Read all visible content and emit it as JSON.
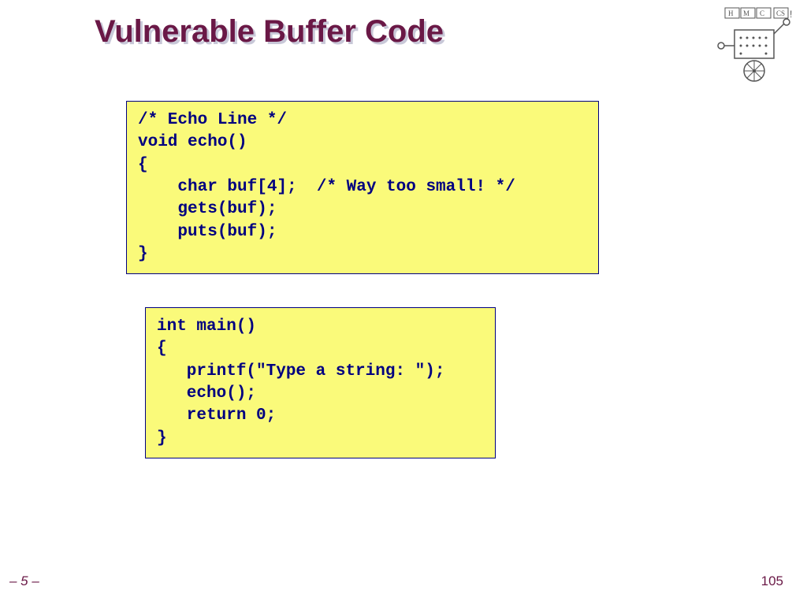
{
  "title": "Vulnerable Buffer Code",
  "code_block_1": "/* Echo Line */\nvoid echo()\n{\n    char buf[4];  /* Way too small! */\n    gets(buf);\n    puts(buf);\n}",
  "code_block_2": "int main()\n{\n   printf(\"Type a string: \");\n   echo();\n   return 0;\n}",
  "footer_left": "– 5 –",
  "footer_right": "105",
  "logo_text": "HMC CS"
}
